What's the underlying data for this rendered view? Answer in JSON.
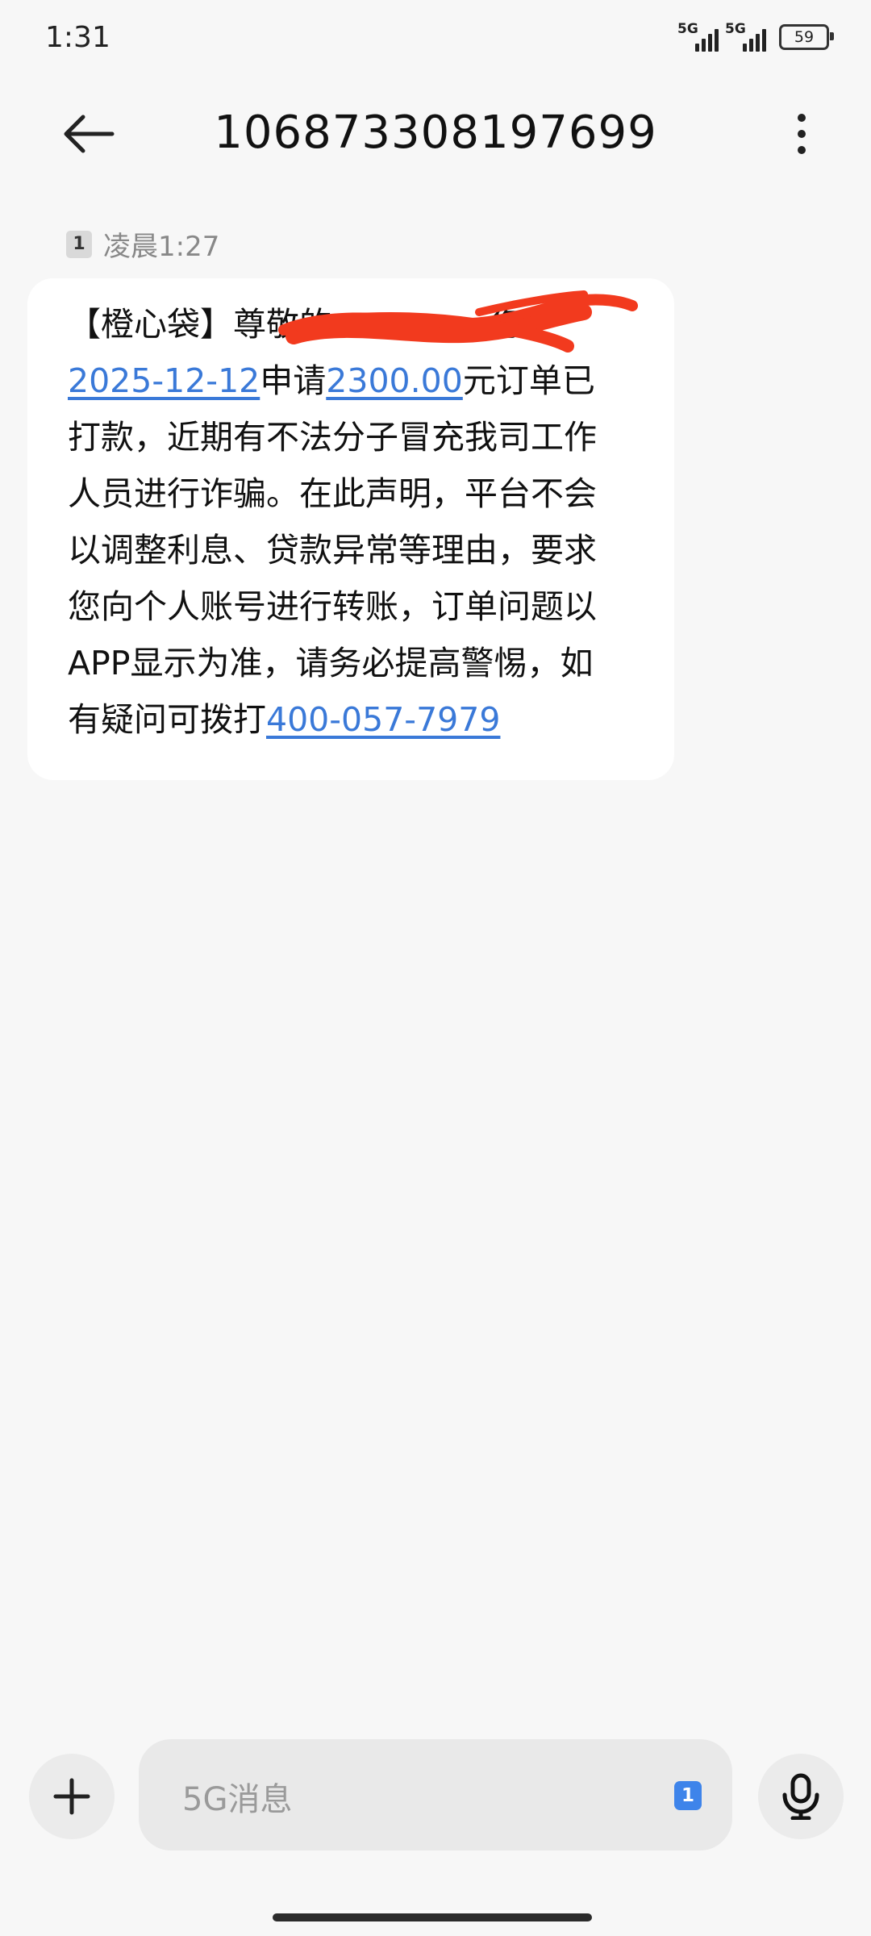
{
  "status_bar": {
    "time": "1:31",
    "network_1": "5G",
    "network_2": "5G",
    "battery": "59"
  },
  "header": {
    "back_icon": "arrow-left-icon",
    "title": "106873308197699",
    "more_icon": "more-vertical-icon"
  },
  "conversation": {
    "sim_badge": "1",
    "timestamp": "凌晨1:27",
    "message": {
      "line1_a": "【橙心袋】尊敬的",
      "line1_b": "您",
      "line2_date": "2025-12-12",
      "line2_mid": "申请",
      "line2_amount": "2300.00",
      "line2_end": "元订单已",
      "line3": "打款，近期有不法分子冒充我司工作",
      "line4": "人员进行诈骗。在此声明，平台不会",
      "line5": "以调整利息、贷款异常等理由，要求",
      "line6": "您向个人账号进行转账，订单问题以",
      "line7": "APP显示为准，请务必提高警惕，如",
      "line8_a": "有疑问可拨打",
      "line8_phone": "400-057-7979"
    }
  },
  "input_bar": {
    "add_icon": "plus-icon",
    "placeholder": "5G消息",
    "sim_chip": "1",
    "mic_icon": "microphone-icon"
  },
  "colors": {
    "link": "#3a79d8",
    "redaction": "#f23a1e",
    "background": "#f7f7f7"
  }
}
